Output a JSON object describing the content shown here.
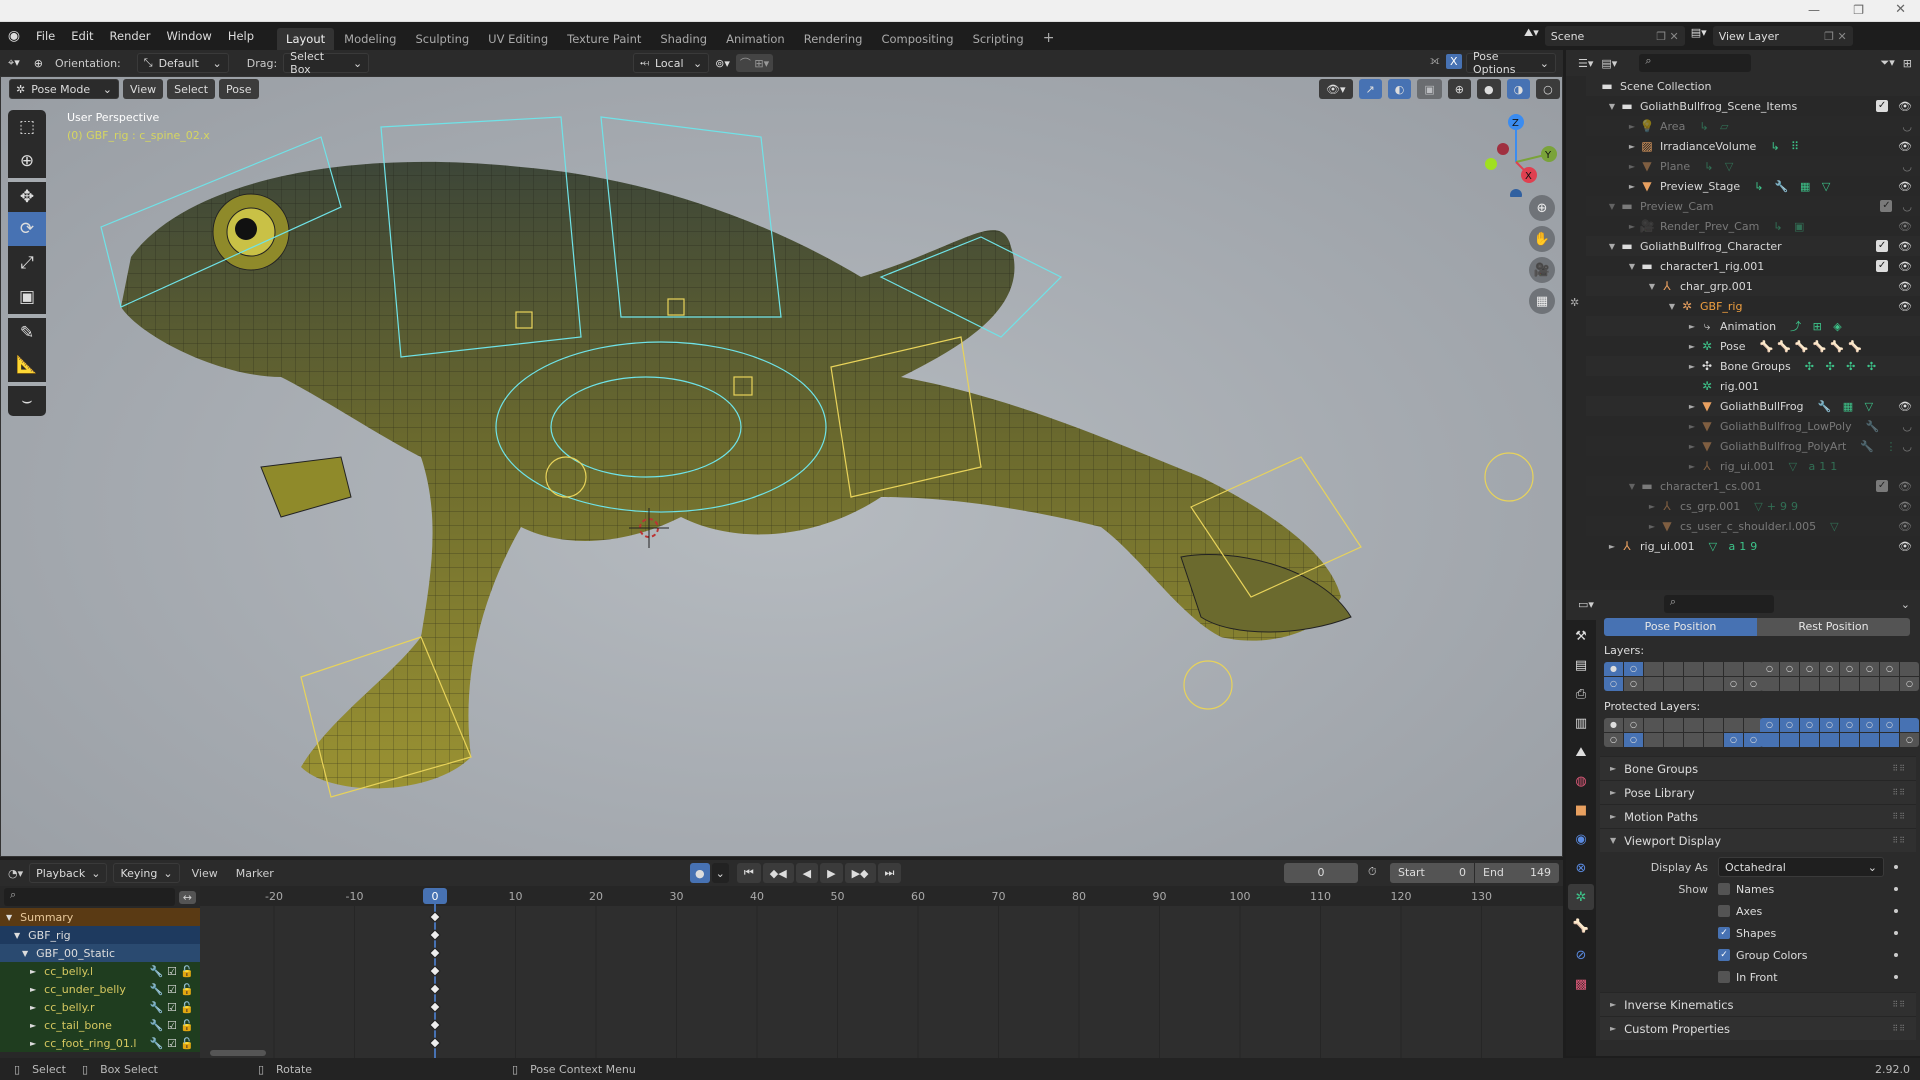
{
  "app": {
    "version": "2.92.0"
  },
  "menu": {
    "items": [
      "File",
      "Edit",
      "Render",
      "Window",
      "Help"
    ]
  },
  "workspaces": {
    "active": 0,
    "tabs": [
      "Layout",
      "Modeling",
      "Sculpting",
      "UV Editing",
      "Texture Paint",
      "Shading",
      "Animation",
      "Rendering",
      "Compositing",
      "Scripting"
    ],
    "add": "+"
  },
  "scene": {
    "scene_name": "Scene",
    "view_layer": "View Layer"
  },
  "viewport_header": {
    "orientation_label": "Orientation:",
    "orientation_value": "Default",
    "drag_label": "Drag:",
    "drag_value": "Select Box",
    "pivot_value": "Local",
    "x_mirror": "X",
    "pose_options": "Pose Options"
  },
  "viewport": {
    "mode": "Pose Mode",
    "menus": [
      "View",
      "Select",
      "Pose"
    ],
    "perspective": "User Perspective",
    "active_info": "(0) GBF_rig : c_spine_02.x",
    "gizmo": {
      "z": "Z",
      "y": "Y",
      "x": "X"
    },
    "tools": [
      "select-box",
      "cursor",
      "move",
      "rotate",
      "scale",
      "transform",
      "annotate",
      "measure",
      "bone-envelope"
    ],
    "active_tool": "rotate",
    "colors": {
      "accent": "#4772b3",
      "bone_shape": "#6fe3e8",
      "bone_selected": "#e8d35a"
    }
  },
  "outliner": {
    "rows": [
      {
        "name": "Scene Collection",
        "depth": 0,
        "icon": "collection-icon",
        "tri": "",
        "dim": false
      },
      {
        "name": "GoliathBullfrog_Scene_Items",
        "depth": 1,
        "icon": "collection-icon",
        "tri": "▼",
        "check": true,
        "eye": true
      },
      {
        "name": "Area",
        "depth": 2,
        "icon": "light-icon",
        "tri": "►",
        "dim": true,
        "extras": "↳ ▱",
        "eye": false
      },
      {
        "name": "IrradianceVolume",
        "depth": 2,
        "icon": "lightprobe-icon",
        "tri": "►",
        "extras": "↳ ⠿",
        "eye": true
      },
      {
        "name": "Plane",
        "depth": 2,
        "icon": "mesh-icon",
        "tri": "►",
        "dim": true,
        "extras": "↳ ▽",
        "eye": false
      },
      {
        "name": "Preview_Stage",
        "depth": 2,
        "icon": "mesh-icon",
        "tri": "►",
        "extras": "↳ 🔧 ▦ ▽",
        "eye": true
      },
      {
        "name": "Preview_Cam",
        "depth": 1,
        "icon": "collection-icon",
        "tri": "▼",
        "dim": true,
        "check": true,
        "eye": false
      },
      {
        "name": "Render_Prev_Cam",
        "depth": 2,
        "icon": "camera-icon",
        "tri": "►",
        "dim": true,
        "extras": "↳ ▣",
        "eye": true
      },
      {
        "name": "GoliathBullfrog_Character",
        "depth": 1,
        "icon": "collection-icon",
        "tri": "▼",
        "check": true,
        "eye": true
      },
      {
        "name": "character1_rig.001",
        "depth": 2,
        "icon": "collection-icon",
        "tri": "▼",
        "check": true,
        "eye": true
      },
      {
        "name": "char_grp.001",
        "depth": 3,
        "icon": "empty-icon",
        "tri": "▼",
        "eye": true
      },
      {
        "name": "GBF_rig",
        "depth": 4,
        "icon": "armature-icon",
        "tri": "▼",
        "active": true,
        "eye": true
      },
      {
        "name": "Animation",
        "depth": 5,
        "icon": "action-icon",
        "tri": "►",
        "extras": "⤴ ⊞ ◈"
      },
      {
        "name": "Pose",
        "depth": 5,
        "icon": "pose-icon",
        "tri": "►",
        "extras": "🦴🦴🦴🦴🦴🦴"
      },
      {
        "name": "Bone Groups",
        "depth": 5,
        "icon": "bone-group-icon",
        "tri": "►",
        "extras": "✣ ✣ ✣ ✣"
      },
      {
        "name": "rig.001",
        "depth": 5,
        "icon": "armature-data-icon",
        "tri": ""
      },
      {
        "name": "GoliathBullFrog",
        "depth": 5,
        "icon": "mesh-icon",
        "tri": "►",
        "extras": "🔧 ▦ ▽",
        "eye": true
      },
      {
        "name": "GoliathBullfrog_LowPoly",
        "depth": 5,
        "icon": "mesh-icon",
        "tri": "►",
        "dim": true,
        "extras": "🔧",
        "eye": false
      },
      {
        "name": "GoliathBullfrog_PolyArt",
        "depth": 5,
        "icon": "mesh-icon",
        "tri": "►",
        "dim": true,
        "extras": "🔧 ⋮",
        "eye": false
      },
      {
        "name": "rig_ui.001",
        "depth": 5,
        "icon": "empty-icon",
        "tri": "►",
        "dim": true,
        "extras": "▽ a11"
      },
      {
        "name": "character1_cs.001",
        "depth": 2,
        "icon": "collection-icon",
        "tri": "▼",
        "dim": true,
        "check": true,
        "eye": true
      },
      {
        "name": "cs_grp.001",
        "depth": 3,
        "icon": "empty-icon",
        "tri": "►",
        "dim": true,
        "extras": "▽+99",
        "eye": true
      },
      {
        "name": "cs_user_c_shoulder.l.005",
        "depth": 3,
        "icon": "mesh-icon",
        "tri": "►",
        "dim": true,
        "extras": "▽",
        "eye": true
      },
      {
        "name": "rig_ui.001",
        "depth": 1,
        "icon": "empty-icon",
        "tri": "►",
        "extras": "▽ a19",
        "eye": true
      }
    ]
  },
  "properties": {
    "pose_position": "Pose Position",
    "rest_position": "Rest Position",
    "pose_position_active": true,
    "layers_label": "Layers:",
    "protected_layers_label": "Protected Layers:",
    "layers": {
      "left_on": [
        0,
        1,
        8
      ],
      "left_marks": {
        "0": "●",
        "1": "○",
        "8": "○",
        "9": "○",
        "14": "○",
        "15": "○"
      },
      "right_on": [],
      "right_marks": {
        "0": "○",
        "1": "○",
        "2": "○",
        "3": "○",
        "4": "○",
        "5": "○",
        "6": "○",
        "15": "○"
      }
    },
    "protected": {
      "left_on": [
        9,
        14,
        15
      ],
      "left_marks": {
        "0": "●",
        "1": "○",
        "8": "○",
        "9": "○",
        "14": "○",
        "15": "○"
      },
      "right_on": [
        0,
        1,
        2,
        3,
        4,
        5,
        6,
        7,
        8,
        9,
        10,
        11,
        12,
        13,
        14
      ],
      "right_marks": {
        "0": "○",
        "1": "○",
        "2": "○",
        "3": "○",
        "4": "○",
        "5": "○",
        "6": "○",
        "15": "○"
      }
    },
    "panels_top": [
      "Bone Groups",
      "Pose Library",
      "Motion Paths"
    ],
    "viewport_display": {
      "title": "Viewport Display",
      "display_as_label": "Display As",
      "display_as_value": "Octahedral",
      "show_label": "Show",
      "options": [
        {
          "label": "Names",
          "checked": false
        },
        {
          "label": "Axes",
          "checked": false
        },
        {
          "label": "Shapes",
          "checked": true
        },
        {
          "label": "Group Colors",
          "checked": true
        },
        {
          "label": "In Front",
          "checked": false
        }
      ]
    },
    "panels_bottom": [
      "Inverse Kinematics",
      "Custom Properties"
    ],
    "tabs": [
      "tool",
      "render",
      "output",
      "view-layer",
      "scene",
      "world",
      "object",
      "physics",
      "object-constraints",
      "object-data-armature",
      "bone",
      "bone-constraints",
      "texture"
    ]
  },
  "timeline": {
    "menus": [
      "Playback",
      "Keying",
      "View",
      "Marker"
    ],
    "current_frame": "0",
    "start_label": "Start",
    "start": "0",
    "end_label": "End",
    "end": "149",
    "ticks": [
      "-20",
      "-10",
      "0",
      "10",
      "20",
      "30",
      "40",
      "50",
      "60",
      "70",
      "80",
      "90",
      "100",
      "110",
      "120",
      "130"
    ],
    "channels": [
      {
        "name": "Summary",
        "type": "summary"
      },
      {
        "name": "GBF_rig",
        "type": "object"
      },
      {
        "name": "GBF_00_Static",
        "type": "action"
      },
      {
        "name": "cc_belly.l",
        "type": "group"
      },
      {
        "name": "cc_under_belly",
        "type": "group"
      },
      {
        "name": "cc_belly.r",
        "type": "group"
      },
      {
        "name": "cc_tail_bone",
        "type": "group"
      },
      {
        "name": "cc_foot_ring_01.l",
        "type": "group"
      }
    ]
  },
  "statusbar": {
    "items": [
      "Select",
      "Box Select",
      "Rotate",
      "Pose Context Menu"
    ],
    "version": "2.92.0"
  }
}
